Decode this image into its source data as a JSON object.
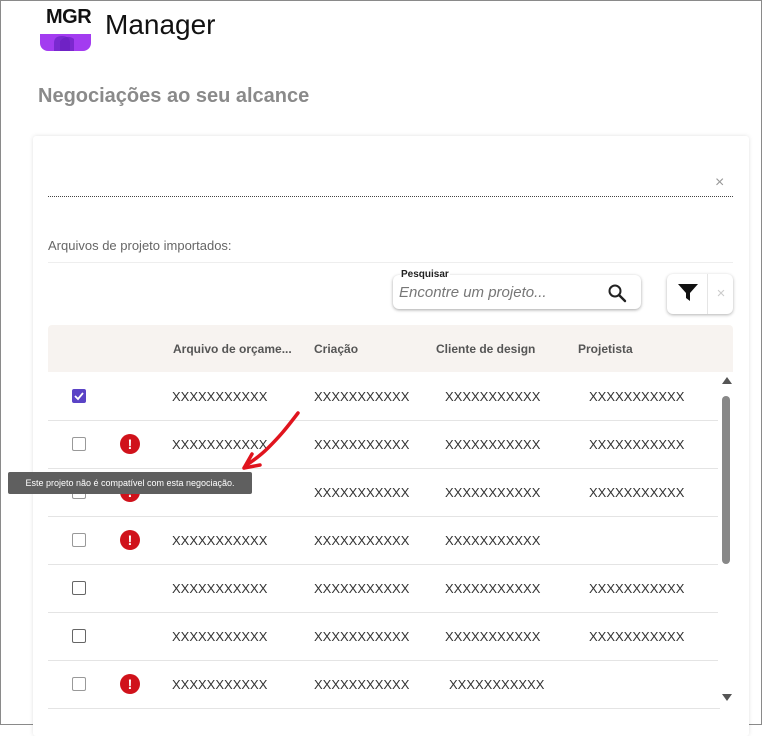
{
  "app": {
    "logo_text": "MGR",
    "title": "Manager"
  },
  "page": {
    "title": "Negociações ao seu alcance"
  },
  "panel": {
    "close_symbol": "×",
    "section_label": "Arquivos de projeto importados:"
  },
  "search": {
    "label": "Pesquisar",
    "placeholder": "Encontre um projeto...",
    "icon": "search-icon"
  },
  "filter": {
    "icon": "filter-icon",
    "clear_symbol": "×"
  },
  "table": {
    "columns": [
      "Arquivo de orçame...",
      "Criação",
      "Cliente de design",
      "Projetista"
    ],
    "rows": [
      {
        "checked": true,
        "warning": false,
        "cells": [
          "XXXXXXXXXXX",
          "XXXXXXXXXXX",
          "XXXXXXXXXXX",
          "XXXXXXXXXXX"
        ]
      },
      {
        "checked": false,
        "warning": true,
        "cells": [
          "XXXXXXXXXXX",
          "XXXXXXXXXXX",
          "XXXXXXXXXXX",
          "XXXXXXXXXXX"
        ]
      },
      {
        "checked": false,
        "warning": true,
        "cells": [
          "",
          "XXXXXXXXXXX",
          "XXXXXXXXXXX",
          "XXXXXXXXXXX"
        ]
      },
      {
        "checked": false,
        "warning": true,
        "cells": [
          "XXXXXXXXXXX",
          "XXXXXXXXXXX",
          "XXXXXXXXXXX",
          ""
        ]
      },
      {
        "checked": false,
        "warning": false,
        "cells": [
          "XXXXXXXXXXX",
          "XXXXXXXXXXX",
          "XXXXXXXXXXX",
          "XXXXXXXXXXX"
        ]
      },
      {
        "checked": false,
        "warning": false,
        "cells": [
          "XXXXXXXXXXX",
          "XXXXXXXXXXX",
          "XXXXXXXXXXX",
          "XXXXXXXXXXX"
        ]
      },
      {
        "checked": false,
        "warning": true,
        "cells": [
          "XXXXXXXXXXX",
          "XXXXXXXXXXX",
          "XXXXXXXXXXX",
          ""
        ]
      }
    ],
    "warning_symbol": "!"
  },
  "tooltip": {
    "text": "Este projeto não é compatível com esta negociação."
  },
  "colors": {
    "accent": "#5a43c6",
    "warning": "#d0121b",
    "annotation_arrow": "#e0141e",
    "header_bg": "#f7f3f0"
  }
}
